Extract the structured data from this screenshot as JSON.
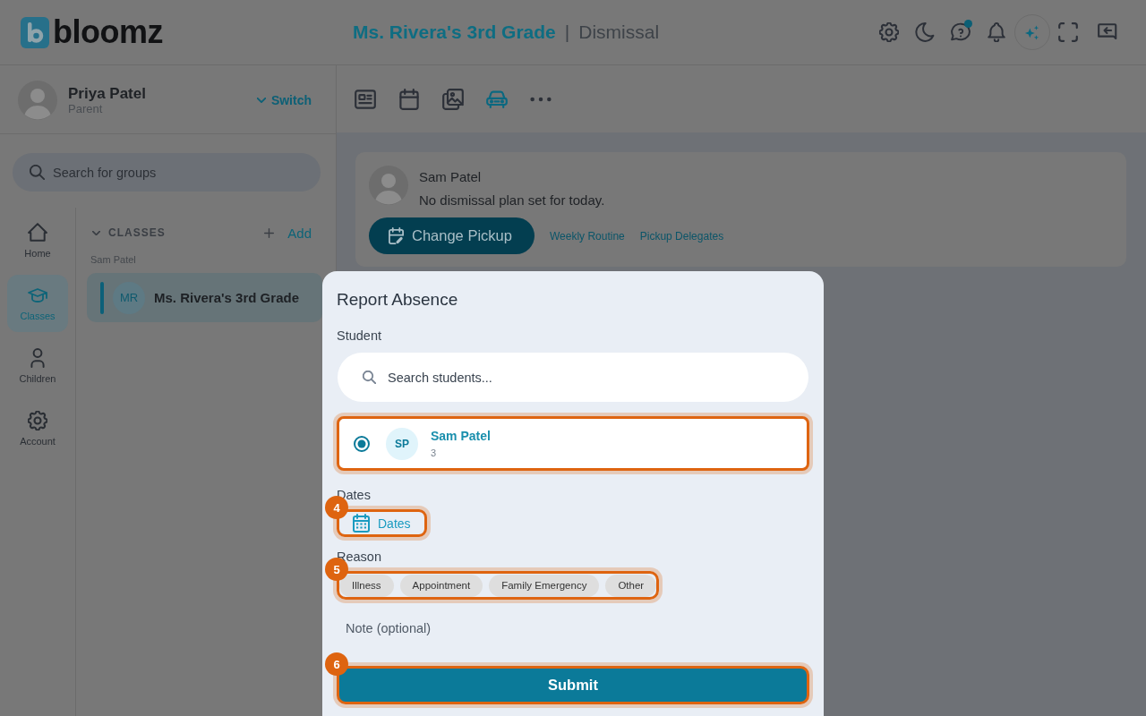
{
  "header": {
    "logo": "bloomz",
    "title": "Ms. Rivera's 3rd Grade",
    "separator": "|",
    "subtitle": "Dismissal",
    "actions": [
      {
        "kind": "settings",
        "dot": false
      },
      {
        "kind": "moon",
        "dot": false
      },
      {
        "kind": "help",
        "dot": true
      },
      {
        "kind": "bell",
        "dot": false
      },
      {
        "kind": "sparkle",
        "dot": false
      },
      {
        "kind": "expand",
        "dot": false
      },
      {
        "kind": "exit",
        "dot": false
      }
    ]
  },
  "sidebar": {
    "profile": {
      "name": "Priya Patel",
      "role": "Parent",
      "switch": "Switch"
    },
    "search": {
      "placeholder": "Search for groups"
    },
    "nav": [
      {
        "kind": "home",
        "label": "Home",
        "selected": false
      },
      {
        "kind": "classes",
        "label": "Classes",
        "selected": true
      },
      {
        "kind": "children",
        "label": "Children",
        "selected": false
      },
      {
        "kind": "account",
        "label": "Account",
        "selected": false
      }
    ],
    "classes": {
      "heading": "CLASSES",
      "expanded": true,
      "add": "Add",
      "group": "Sam Patel",
      "items": [
        {
          "initials": "MR",
          "name": "Ms. Rivera's 3rd Grade",
          "selected": true
        }
      ]
    }
  },
  "toolbar": {
    "tabs": [
      {
        "kind": "card",
        "selected": false
      },
      {
        "kind": "calendar",
        "selected": false
      },
      {
        "kind": "photos",
        "selected": false
      },
      {
        "kind": "car",
        "selected": true
      },
      {
        "kind": "more",
        "selected": false
      }
    ]
  },
  "dismissal_card": {
    "name": "Sam Patel",
    "message": "No dismissal plan set for today.",
    "button": "Change Pickup",
    "links": [
      "Weekly Routine",
      "Pickup Delegates"
    ]
  },
  "modal": {
    "title": "Report Absence",
    "student_label": "Student",
    "search": {
      "placeholder": "Search students..."
    },
    "students": [
      {
        "initials": "SP",
        "name": "Sam Patel",
        "detail": "3",
        "selected": true,
        "highlighted": true
      }
    ],
    "dates_label": "Dates",
    "dates_button": {
      "label": "Dates",
      "highlighted": true,
      "step": "4"
    },
    "reason_label": "Reason",
    "reasons": {
      "highlighted": true,
      "step": "5",
      "options": [
        {
          "label": "Illness",
          "selected": false
        },
        {
          "label": "Appointment",
          "selected": false
        },
        {
          "label": "Family Emergency",
          "selected": false
        },
        {
          "label": "Other",
          "selected": false
        }
      ]
    },
    "note": {
      "placeholder": "Note (optional)"
    },
    "submit": {
      "label": "Submit",
      "highlighted": true,
      "step": "6"
    }
  }
}
